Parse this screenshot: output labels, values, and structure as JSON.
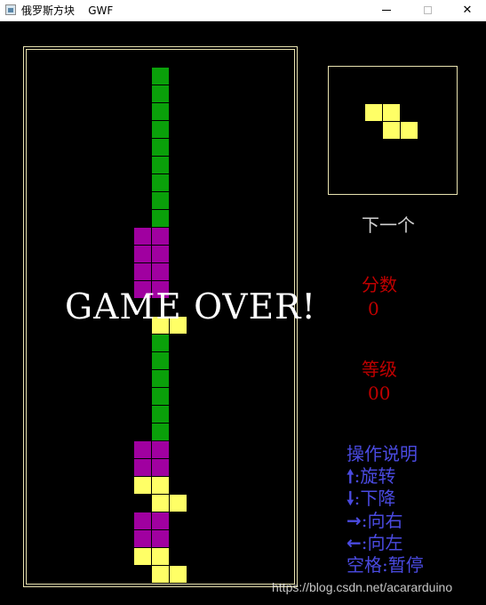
{
  "window": {
    "title": "俄罗斯方块    GWF",
    "icon": "app-window-icon",
    "buttons": {
      "minimize": "minimize",
      "maximize": "maximize",
      "close": "✕"
    }
  },
  "board": {
    "columns": 15,
    "colors": {
      "green": "#0aa00a",
      "magenta": "#a000a0",
      "yellow": "#ffff66"
    },
    "blocks": [
      {
        "col": 7,
        "row": 0,
        "color": "g"
      },
      {
        "col": 7,
        "row": 1,
        "color": "g"
      },
      {
        "col": 7,
        "row": 2,
        "color": "g"
      },
      {
        "col": 7,
        "row": 3,
        "color": "g"
      },
      {
        "col": 7,
        "row": 4,
        "color": "g"
      },
      {
        "col": 7,
        "row": 5,
        "color": "g"
      },
      {
        "col": 7,
        "row": 6,
        "color": "g"
      },
      {
        "col": 7,
        "row": 7,
        "color": "g"
      },
      {
        "col": 7,
        "row": 8,
        "color": "g"
      },
      {
        "col": 6,
        "row": 9,
        "color": "m"
      },
      {
        "col": 7,
        "row": 9,
        "color": "m"
      },
      {
        "col": 6,
        "row": 10,
        "color": "m"
      },
      {
        "col": 7,
        "row": 10,
        "color": "m"
      },
      {
        "col": 6,
        "row": 11,
        "color": "m"
      },
      {
        "col": 7,
        "row": 11,
        "color": "m"
      },
      {
        "col": 6,
        "row": 12,
        "color": "m"
      },
      {
        "col": 7,
        "row": 12,
        "color": "m"
      },
      {
        "col": 7,
        "row": 14,
        "color": "y"
      },
      {
        "col": 8,
        "row": 14,
        "color": "y"
      },
      {
        "col": 7,
        "row": 15,
        "color": "g"
      },
      {
        "col": 7,
        "row": 16,
        "color": "g"
      },
      {
        "col": 7,
        "row": 17,
        "color": "g"
      },
      {
        "col": 7,
        "row": 18,
        "color": "g"
      },
      {
        "col": 7,
        "row": 19,
        "color": "g"
      },
      {
        "col": 7,
        "row": 20,
        "color": "g"
      },
      {
        "col": 6,
        "row": 21,
        "color": "m"
      },
      {
        "col": 7,
        "row": 21,
        "color": "m"
      },
      {
        "col": 6,
        "row": 22,
        "color": "m"
      },
      {
        "col": 7,
        "row": 22,
        "color": "m"
      },
      {
        "col": 6,
        "row": 23,
        "color": "y"
      },
      {
        "col": 7,
        "row": 23,
        "color": "y"
      },
      {
        "col": 7,
        "row": 24,
        "color": "y"
      },
      {
        "col": 8,
        "row": 24,
        "color": "y"
      },
      {
        "col": 6,
        "row": 25,
        "color": "m"
      },
      {
        "col": 7,
        "row": 25,
        "color": "m"
      },
      {
        "col": 6,
        "row": 26,
        "color": "m"
      },
      {
        "col": 7,
        "row": 26,
        "color": "m"
      },
      {
        "col": 6,
        "row": 27,
        "color": "y"
      },
      {
        "col": 7,
        "row": 27,
        "color": "y"
      },
      {
        "col": 7,
        "row": 28,
        "color": "y"
      },
      {
        "col": 8,
        "row": 28,
        "color": "y"
      }
    ],
    "game_over_text": "GAME OVER!"
  },
  "next_piece": {
    "label": "下一个",
    "color": "#ffff66",
    "cells": [
      {
        "col": 0,
        "row": 0
      },
      {
        "col": 1,
        "row": 0
      },
      {
        "col": 1,
        "row": 1
      },
      {
        "col": 2,
        "row": 1
      }
    ]
  },
  "score": {
    "label": "分数",
    "value": "0"
  },
  "level": {
    "label": "等级",
    "value": "00"
  },
  "help": {
    "title": "操作说明",
    "items": [
      {
        "icon": "arrow-up-icon",
        "glyph": "🠕",
        "text": ":旋转"
      },
      {
        "icon": "arrow-down-icon",
        "glyph": "🠗",
        "text": ":下降"
      },
      {
        "icon": "arrow-right-icon",
        "glyph": "→",
        "text": ":向右"
      },
      {
        "icon": "arrow-left-icon",
        "glyph": "←",
        "text": ":向左"
      }
    ],
    "space_text": "空格:暂停"
  },
  "watermark": "https://blog.csdn.net/acararduino"
}
